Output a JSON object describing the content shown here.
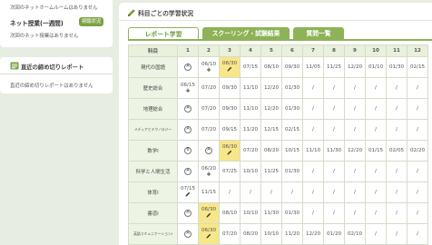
{
  "left": {
    "homeroom_note": "次回のネットホームルームはありません",
    "net_class_title": "ネット授業(一週間)",
    "status_button": "視聴状況",
    "net_class_note": "次回のネット授業はありません",
    "deadline_title": "直近の締め切りレポート",
    "deadline_note": "直近の締め切りレポートはありません"
  },
  "panel": {
    "title": "科目ごとの学習状況",
    "tabs": [
      "レポート学習",
      "スクーリング・試験結果",
      "質問一覧"
    ],
    "active_tab": 0
  },
  "table": {
    "header_subject": "科目",
    "columns": [
      "1",
      "2",
      "3",
      "4",
      "5",
      "6",
      "7",
      "8",
      "9",
      "10",
      "11",
      "12"
    ],
    "rows": [
      {
        "subject": "現代の国語",
        "tiny": false,
        "cells": [
          {
            "circle": "A"
          },
          {
            "date": "06/10",
            "mark": "+"
          },
          {
            "date": "06/30",
            "pencil": true,
            "hl": true
          },
          {
            "date": "07/15"
          },
          {
            "date": "08/10"
          },
          {
            "date": "09/30"
          },
          {
            "date": "11/05"
          },
          {
            "date": "11/25"
          },
          {
            "date": "12/20"
          },
          {
            "date": "01/10"
          },
          {
            "date": "01/30"
          },
          {
            "date": "02/15"
          }
        ]
      },
      {
        "subject": "歴史総合",
        "tiny": false,
        "cells": [
          {
            "date": "06/15",
            "mark": "+"
          },
          {
            "date": "07/20"
          },
          {
            "date": "09/30"
          },
          {
            "date": "11/10"
          },
          {
            "date": "12/20"
          },
          {
            "date": "01/30"
          },
          {
            "date": "/"
          },
          {
            "date": "/"
          },
          {
            "date": "/"
          },
          {
            "date": "/"
          },
          {
            "date": "/"
          },
          {
            "date": "/"
          }
        ]
      },
      {
        "subject": "地理総合",
        "tiny": false,
        "cells": [
          {
            "circle": "A"
          },
          {
            "date": "07/20"
          },
          {
            "date": "09/30"
          },
          {
            "date": "11/10"
          },
          {
            "date": "12/20"
          },
          {
            "date": "01/30"
          },
          {
            "date": "/"
          },
          {
            "date": "/"
          },
          {
            "date": "/"
          },
          {
            "date": "/"
          },
          {
            "date": "/"
          },
          {
            "date": "/"
          }
        ]
      },
      {
        "subject": "メディアとテクノロジー",
        "tiny": true,
        "cells": [
          {
            "circle": "A"
          },
          {
            "date": "07/20"
          },
          {
            "date": "09/15"
          },
          {
            "date": "11/20"
          },
          {
            "date": "12/15"
          },
          {
            "date": "02/15"
          },
          {
            "date": "/"
          },
          {
            "date": "/"
          },
          {
            "date": "/"
          },
          {
            "date": "/"
          },
          {
            "date": "/"
          },
          {
            "date": "/"
          }
        ]
      },
      {
        "subject": "数学Ⅰ",
        "tiny": false,
        "cells": [
          {
            "circle": "B"
          },
          {
            "circle": "A"
          },
          {
            "date": "06/30",
            "pencil": true,
            "hl": true
          },
          {
            "date": "07/20"
          },
          {
            "date": "08/20"
          },
          {
            "date": "10/15"
          },
          {
            "date": "11/10"
          },
          {
            "date": "11/30"
          },
          {
            "date": "12/20"
          },
          {
            "date": "01/15"
          },
          {
            "date": "02/05"
          },
          {
            "date": "02/20"
          }
        ]
      },
      {
        "subject": "科学と人間生活",
        "tiny": false,
        "cells": [
          {
            "circle": "A"
          },
          {
            "date": "06/20",
            "mark": "+"
          },
          {
            "date": "07/25"
          },
          {
            "date": "10/10"
          },
          {
            "date": "11/25"
          },
          {
            "date": "01/30"
          },
          {
            "date": "/"
          },
          {
            "date": "/"
          },
          {
            "date": "/"
          },
          {
            "date": "/"
          },
          {
            "date": "/"
          },
          {
            "date": "/"
          }
        ]
      },
      {
        "subject": "体育Ⅰ",
        "tiny": false,
        "cells": [
          {
            "date": "07/15",
            "pencil": true
          },
          {
            "date": "11/15"
          },
          {
            "date": "/"
          },
          {
            "date": "/"
          },
          {
            "date": "/"
          },
          {
            "date": "/"
          },
          {
            "date": "/"
          },
          {
            "date": "/"
          },
          {
            "date": "/"
          },
          {
            "date": "/"
          },
          {
            "date": "/"
          },
          {
            "date": "/"
          }
        ]
      },
      {
        "subject": "書道Ⅰ",
        "tiny": false,
        "cells": [
          {
            "circle": "A"
          },
          {
            "date": "06/30",
            "pencil": true,
            "hl": true
          },
          {
            "date": "08/10"
          },
          {
            "date": "10/10"
          },
          {
            "date": "11/30"
          },
          {
            "date": "01/30"
          },
          {
            "date": "/"
          },
          {
            "date": "/"
          },
          {
            "date": "/"
          },
          {
            "date": "/"
          },
          {
            "date": "/"
          },
          {
            "date": "/"
          }
        ]
      },
      {
        "subject": "英語コミュニケーションⅠ",
        "tiny": true,
        "cells": [
          {
            "circle": "A"
          },
          {
            "date": "06/30",
            "pencil": true,
            "hl": true
          },
          {
            "date": "07/20"
          },
          {
            "date": "08/20"
          },
          {
            "date": "10/10"
          },
          {
            "date": "11/20"
          },
          {
            "date": "12/20"
          },
          {
            "date": "01/20"
          },
          {
            "date": "02/10"
          },
          {
            "date": "/"
          },
          {
            "date": "/"
          },
          {
            "date": "/"
          }
        ]
      }
    ]
  }
}
